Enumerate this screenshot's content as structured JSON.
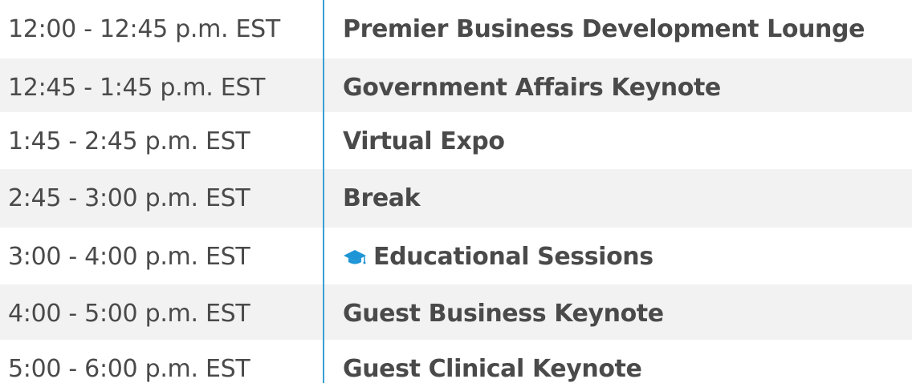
{
  "schedule": {
    "rows": [
      {
        "time": "12:00 - 12:45 p.m. EST",
        "event": "Premier Business Development Lounge"
      },
      {
        "time": "12:45 - 1:45 p.m. EST",
        "event": "Government Affairs Keynote"
      },
      {
        "time": "1:45 - 2:45 p.m. EST",
        "event": "Virtual Expo"
      },
      {
        "time": "2:45 - 3:00 p.m. EST",
        "event": "Break"
      },
      {
        "time": "3:00 - 4:00 p.m. EST",
        "event": "Educational Sessions",
        "icon": "graduation-cap-icon"
      },
      {
        "time": "4:00 - 5:00 p.m. EST",
        "event": "Guest Business Keynote"
      },
      {
        "time": "5:00 - 6:00 p.m. EST",
        "event": "Guest Clinical Keynote"
      }
    ]
  },
  "colors": {
    "divider": "#3a9fd4",
    "icon": "#1e95d6",
    "shaded_row": "#f2f2f2",
    "text": "#4a4a4a"
  }
}
